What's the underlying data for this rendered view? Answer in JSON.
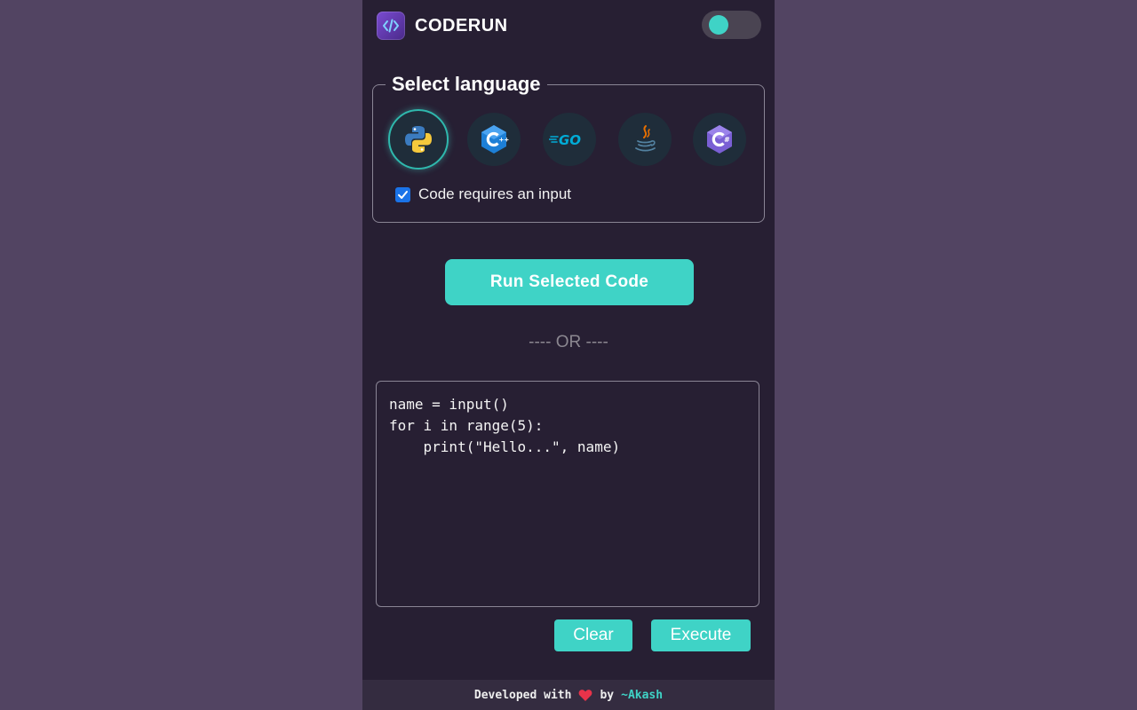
{
  "header": {
    "app_title": "CODERUN",
    "logo_icon": "code-brackets-icon",
    "theme_toggle_on": true
  },
  "language_selector": {
    "legend": "Select language",
    "languages": [
      {
        "name": "Python",
        "icon": "python-icon",
        "selected": true
      },
      {
        "name": "C++",
        "icon": "cpp-icon",
        "selected": false
      },
      {
        "name": "Go",
        "icon": "go-icon",
        "selected": false
      },
      {
        "name": "Java",
        "icon": "java-icon",
        "selected": false
      },
      {
        "name": "C#",
        "icon": "csharp-icon",
        "selected": false
      }
    ],
    "requires_input_label": "Code requires an input",
    "requires_input_checked": true
  },
  "run_button_label": "Run Selected Code",
  "or_divider": "---- OR ----",
  "editor": {
    "code": "name = input()\nfor i in range(5):\n    print(\"Hello...\", name)"
  },
  "actions": {
    "clear_label": "Clear",
    "execute_label": "Execute"
  },
  "footer": {
    "prefix": "Developed with",
    "heart_icon": "heart-icon",
    "by": "by",
    "author": "~Akash"
  },
  "colors": {
    "accent": "#3fd3c6",
    "panel_bg": "#271f33",
    "page_bg": "#524462",
    "checkbox": "#1a73e8"
  }
}
